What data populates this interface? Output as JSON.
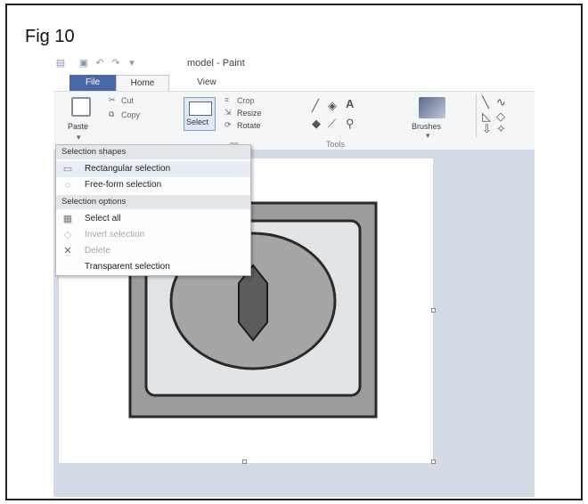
{
  "figure": {
    "label": "Fig 10"
  },
  "window": {
    "title": "model - Paint"
  },
  "tabs": [
    {
      "label": "File"
    },
    {
      "label": "Home"
    },
    {
      "label": "View"
    }
  ],
  "ribbon": {
    "paste_label": "Paste",
    "cut_label": "Cut",
    "copy_label": "Copy",
    "select_label": "Select",
    "crop_label": "Crop",
    "resize_label": "Resize",
    "rotate_label": "Rotate",
    "image_group_label": "ge",
    "tools_group_label": "Tools",
    "brushes_label": "Brushes"
  },
  "selection_menu": {
    "shapes_header": "Selection shapes",
    "shapes": [
      {
        "label": "Rectangular selection",
        "icon": "rectangle-select-icon",
        "enabled": true
      },
      {
        "label": "Free-form selection",
        "icon": "freeform-select-icon",
        "enabled": true
      }
    ],
    "options_header": "Selection options",
    "options": [
      {
        "label": "Select all",
        "icon": "select-all-icon",
        "enabled": true
      },
      {
        "label": "Invert selection",
        "icon": "invert-selection-icon",
        "enabled": false
      },
      {
        "label": "Delete",
        "icon": "delete-icon",
        "enabled": false
      },
      {
        "label": "Transparent selection",
        "icon": "",
        "enabled": true
      }
    ]
  },
  "colors": {
    "file_tab": "#4a67a8",
    "workarea": "#d3dae5",
    "outer_square": "#9c9c9c",
    "inner_square": "#e2e5e8",
    "circle": "#a5a5a5",
    "keyhole": "#5c5c5c"
  }
}
